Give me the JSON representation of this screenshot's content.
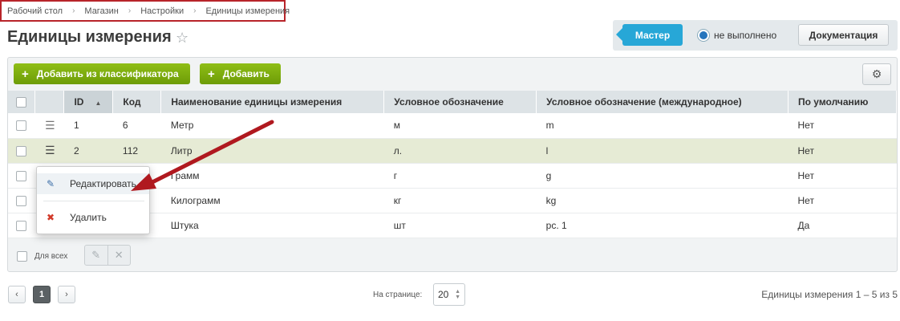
{
  "breadcrumbs": [
    "Рабочий стол",
    "Магазин",
    "Настройки",
    "Единицы измерения"
  ],
  "page_title": "Единицы измерения",
  "master": {
    "button": "Мастер",
    "status": "не выполнено",
    "docs": "Документация"
  },
  "toolbar": {
    "add_from_classifier": "Добавить из классификатора",
    "add": "Добавить"
  },
  "columns": [
    "ID",
    "Код",
    "Наименование единицы измерения",
    "Условное обозначение",
    "Условное обозначение (международное)",
    "По умолчанию"
  ],
  "rows": [
    {
      "id": "1",
      "code": "6",
      "name": "Метр",
      "symbol": "м",
      "intl": "m",
      "default": "Нет"
    },
    {
      "id": "2",
      "code": "112",
      "name": "Литр",
      "symbol": "л.",
      "intl": "l",
      "default": "Нет"
    },
    {
      "id": "",
      "code": "",
      "name": "Грамм",
      "symbol": "г",
      "intl": "g",
      "default": "Нет"
    },
    {
      "id": "",
      "code": "",
      "name": "Килограмм",
      "symbol": "кг",
      "intl": "kg",
      "default": "Нет"
    },
    {
      "id": "",
      "code": "",
      "name": "Штука",
      "symbol": "шт",
      "intl": "pc. 1",
      "default": "Да"
    }
  ],
  "context_menu": {
    "edit": "Редактировать",
    "delete": "Удалить"
  },
  "footer": {
    "for_all": "Для всех"
  },
  "pagination": {
    "current_page": "1",
    "per_page_label": "На странице:",
    "per_page_value": "20",
    "summary": "Единицы измерения 1 – 5 из 5"
  },
  "colors": {
    "accent_blue": "#27a7d7",
    "green": "#7aab0c",
    "arrow_red": "#b0191f",
    "highlight_row": "#e6ebd5"
  }
}
